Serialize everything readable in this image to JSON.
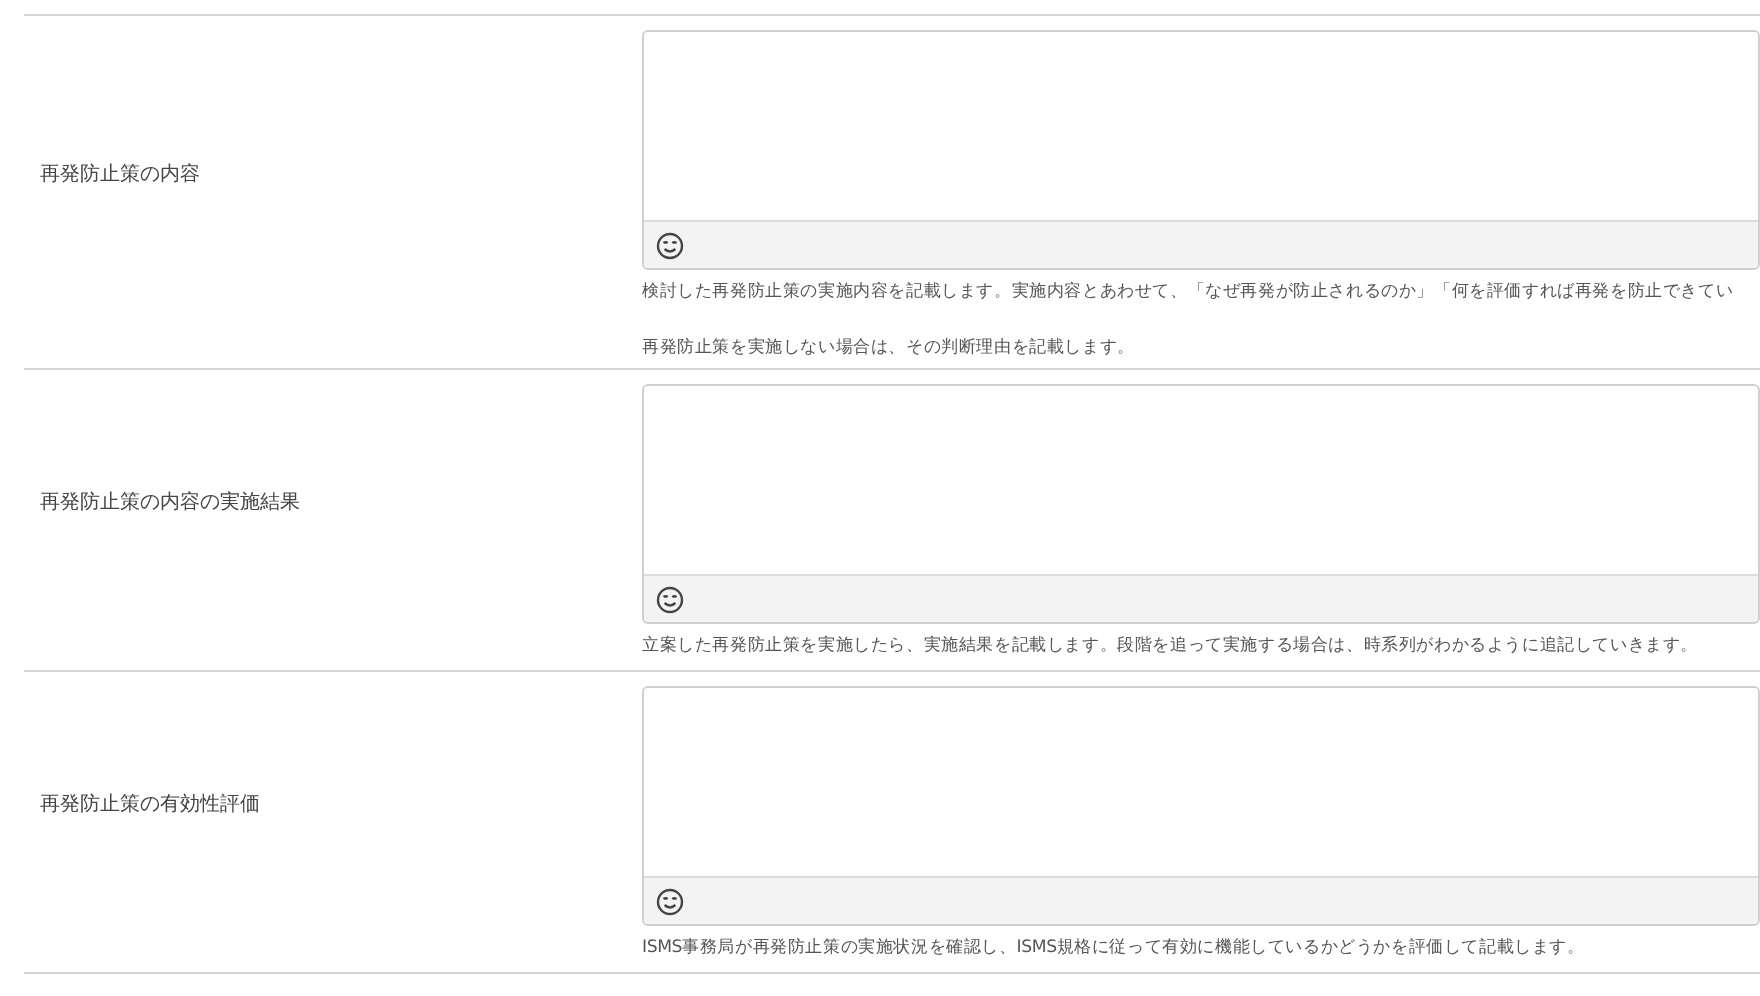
{
  "fields": [
    {
      "label": "再発防止策の内容",
      "help": [
        "検討した再発防止策の実施内容を記載します。実施内容とあわせて、「なぜ再発が防止されるのか」「何を評価すれば再発を防止できてい",
        "再発防止策を実施しない場合は、その判断理由を記載します。"
      ]
    },
    {
      "label": "再発防止策の内容の実施結果",
      "help": [
        "立案した再発防止策を実施したら、実施結果を記載します。段階を追って実施する場合は、時系列がわかるように追記していきます。"
      ]
    },
    {
      "label": "再発防止策の有効性評価",
      "help": [
        "ISMS事務局が再発防止策の実施状況を確認し、ISMS規格に従って有効に機能しているかどうかを評価して記載します。"
      ]
    }
  ]
}
